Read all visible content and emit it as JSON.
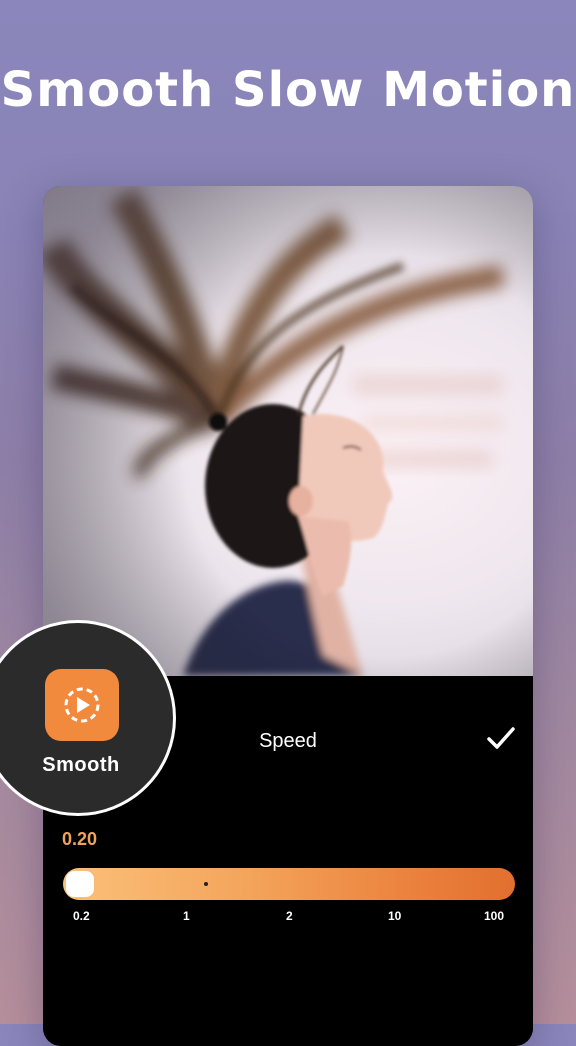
{
  "headline": "Smooth Slow Motion",
  "panel": {
    "title": "Speed",
    "confirm_icon": "checkmark-icon",
    "current_value": "0.20",
    "slider_position": 0.0,
    "tick_labels": [
      "0.2",
      "1",
      "2",
      "10",
      "100"
    ]
  },
  "badge": {
    "icon": "smooth-play-icon",
    "label": "Smooth"
  },
  "colors": {
    "accent": "#f28a3d",
    "value_text": "#f0a35b",
    "background": "#8b86bb"
  }
}
